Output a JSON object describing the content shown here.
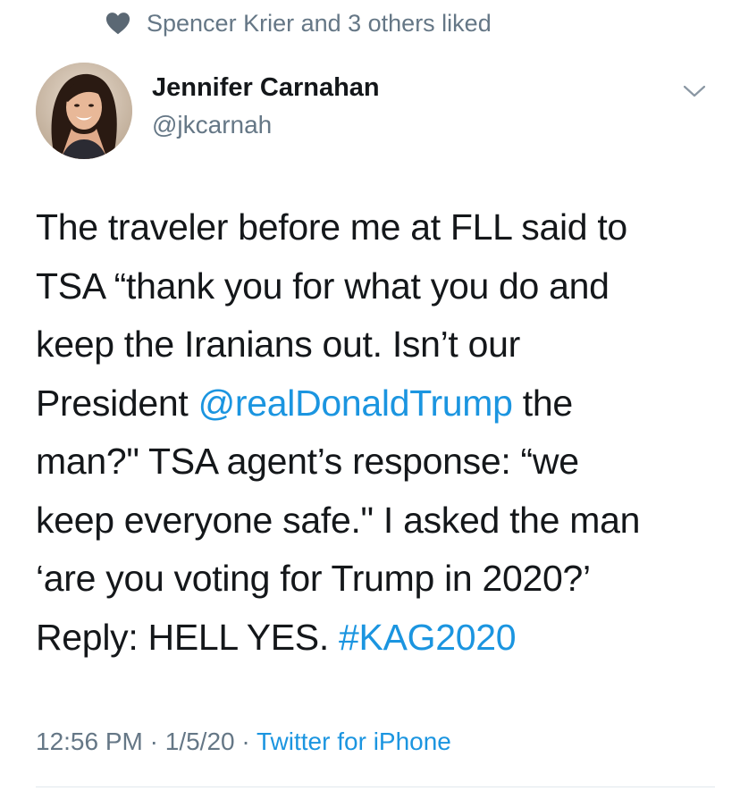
{
  "social_context": {
    "icon": "heart-icon",
    "text": "Spencer Krier and 3 others liked"
  },
  "author": {
    "name": "Jennifer Carnahan",
    "handle": "@jkcarnah",
    "avatar_icon": "avatar-photo"
  },
  "menu": {
    "icon": "chevron-down-icon"
  },
  "tweet": {
    "lines": [
      [
        "The traveler before me at FLL said to"
      ],
      [
        "TSA “thank you for what you do and"
      ],
      [
        "keep the Iranians out. Isn’t our"
      ],
      [
        "President ",
        "@realDonaldTrump",
        " the"
      ],
      [
        "man?\" TSA agent’s response: “we"
      ],
      [
        "keep everyone safe.\" I asked the man"
      ],
      [
        "‘are you voting for Trump in 2020?’"
      ],
      [
        "Reply: HELL YES. ",
        "#KAG2020"
      ]
    ],
    "mention": "@realDonaldTrump",
    "hashtag": "#KAG2020"
  },
  "meta": {
    "time": "12:56 PM",
    "sep1": " · ",
    "date": "1/5/20",
    "sep2": " · ",
    "source": "Twitter for iPhone"
  },
  "colors": {
    "link": "#1b95e0",
    "secondary_text": "#657786",
    "primary_text": "#14171a"
  }
}
